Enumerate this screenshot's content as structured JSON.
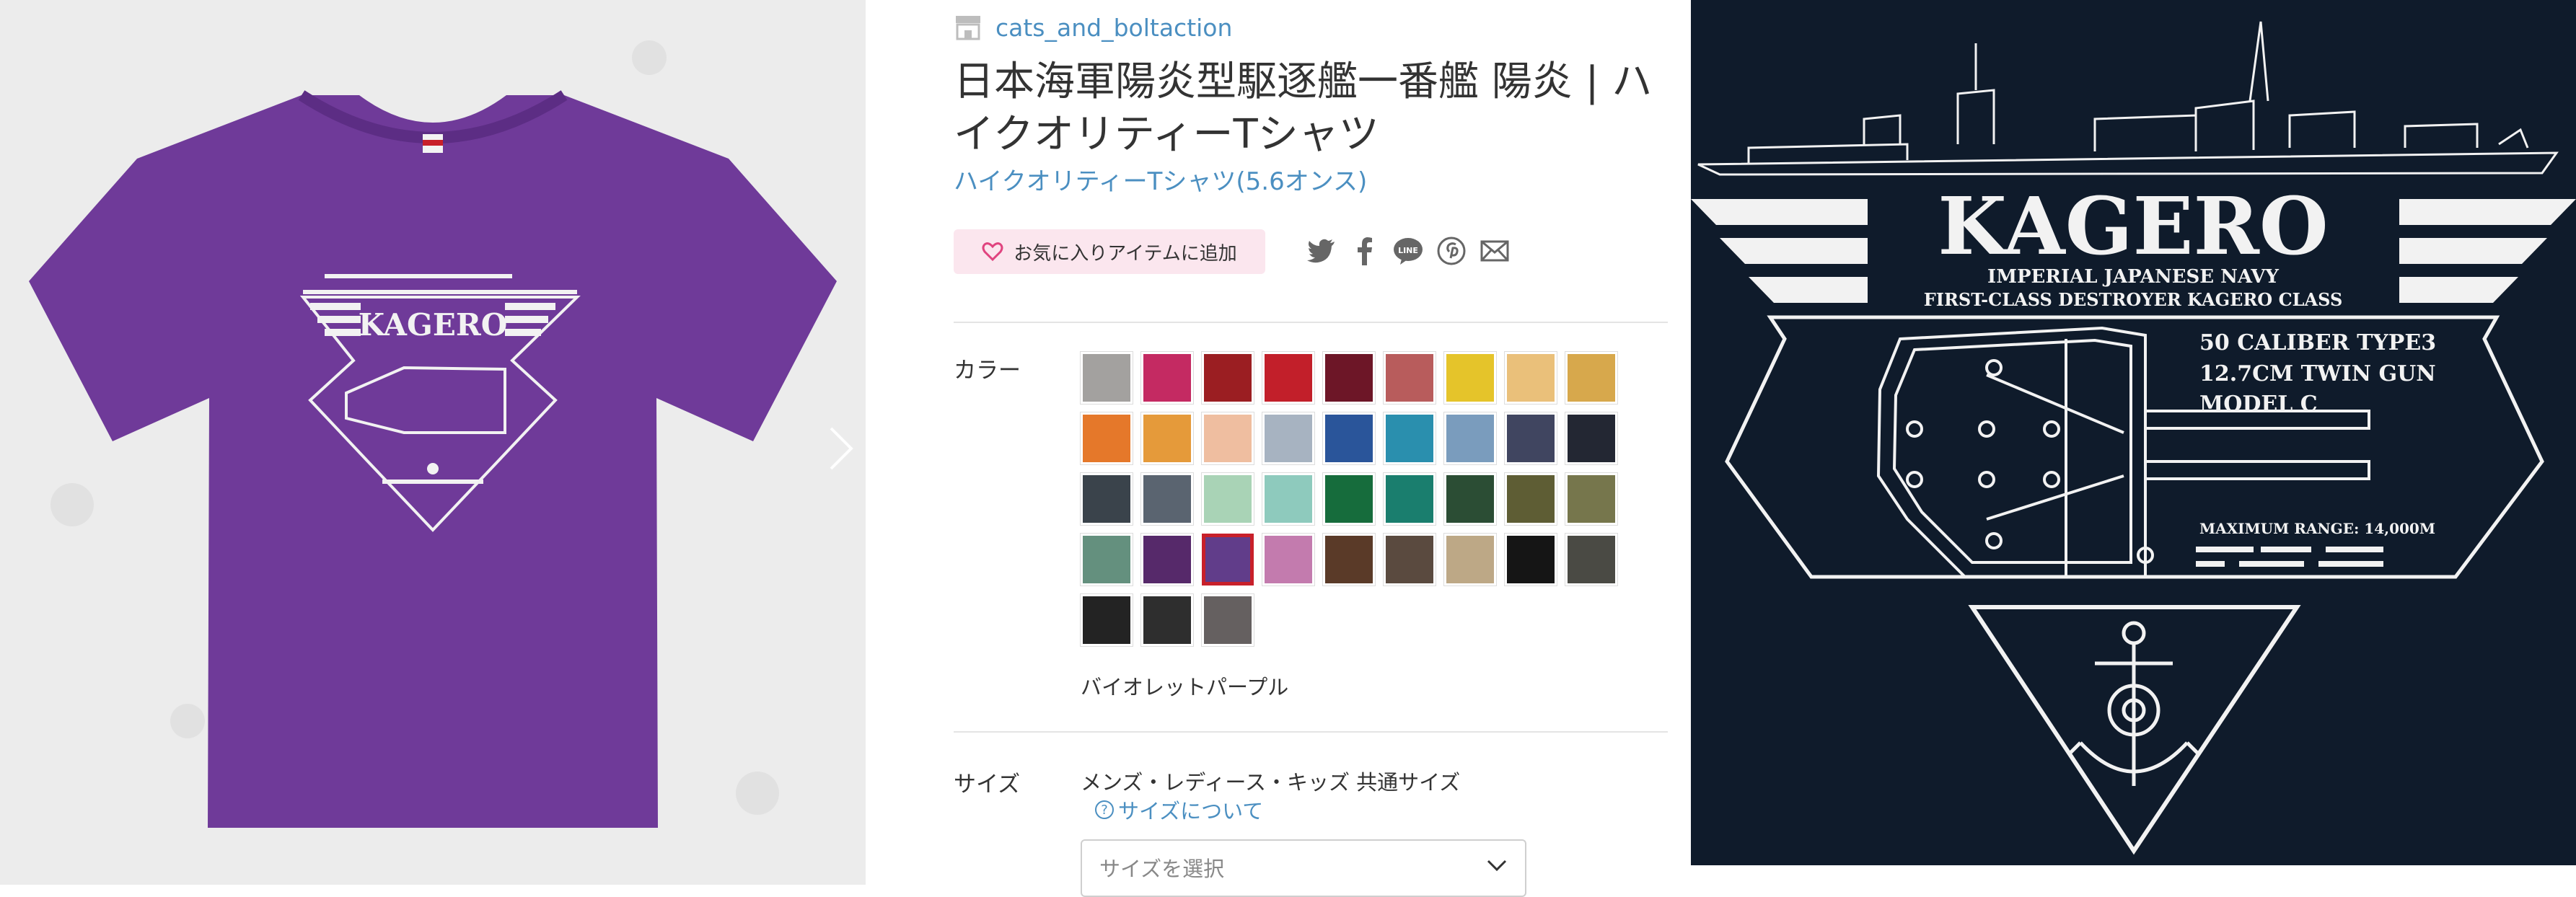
{
  "shop": {
    "name": "cats_and_boltaction",
    "icon": "shop-icon"
  },
  "product": {
    "title": "日本海軍陽炎型駆逐艦一番艦 陽炎 | ハイクオリティーTシャツ",
    "subtitle": "ハイクオリティーTシャツ(5.6オンス)"
  },
  "favorite_label": "お気に入りアイテムに追加",
  "share_icons": [
    "twitter-icon",
    "facebook-icon",
    "line-icon",
    "pinterest-icon",
    "mail-icon"
  ],
  "colors": {
    "label": "カラー",
    "selected_name": "バイオレットパープル",
    "selected_index": 29,
    "swatches": [
      "#a3a19f",
      "#c42a62",
      "#9b1e22",
      "#c21f2a",
      "#6d1627",
      "#b85c5c",
      "#e5c42a",
      "#eac07a",
      "#d7a84c",
      "#e5782a",
      "#e59a3a",
      "#efbea0",
      "#a7b3c1",
      "#2a559a",
      "#2a8fae",
      "#7a9cbd",
      "#404560",
      "#232733",
      "#3a434b",
      "#5a6470",
      "#a9d3b6",
      "#8ecabd",
      "#166c3c",
      "#1a7e6e",
      "#2b4d34",
      "#5e5d34",
      "#76764c",
      "#64907e",
      "#56296a",
      "#613d8a",
      "#c37bae",
      "#5a3a28",
      "#5a4a3f",
      "#bda886",
      "#151515",
      "#4a4a44",
      "#232323",
      "#2e2e2e",
      "#656060"
    ]
  },
  "size": {
    "label": "サイズ",
    "note": "メンズ・レディース・キッズ 共通サイズ",
    "link": "サイズについて",
    "select_placeholder": "サイズを選択"
  },
  "design": {
    "name": "KAGERO",
    "line1": "IMPERIAL JAPANESE NAVY",
    "line2": "FIRST-CLASS DESTROYER KAGERO CLASS",
    "gun1": "50 CALIBER TYPE3",
    "gun2": "12.7CM TWIN GUN",
    "gun3": "MODEL C",
    "range": "MAXIMUM RANGE: 14,000M",
    "bg_color": "#0f1b2b"
  },
  "tshirt_color": "#6f3a99"
}
